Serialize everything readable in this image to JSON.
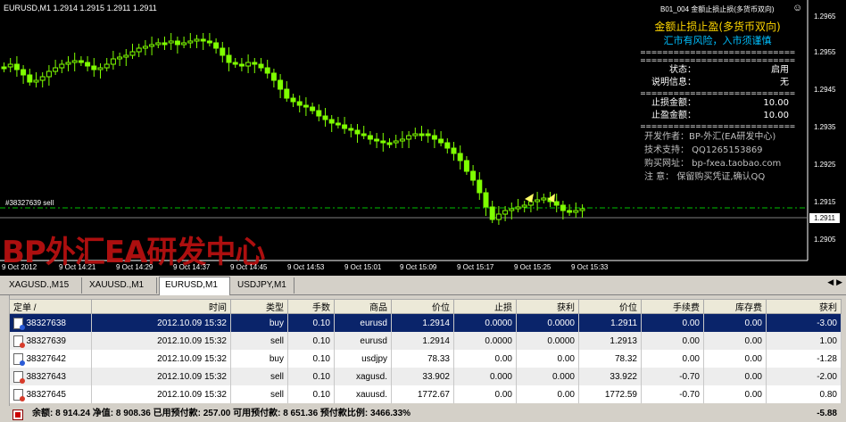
{
  "chart": {
    "title": "EURUSD,M1  1.2914 1.2915 1.2911 1.2911",
    "ea_title": "B01_004 金额止损止损(多货币双向)",
    "order_line_label": "#38327639 sell",
    "watermark": "BP外汇EA研发中心",
    "current_price": "1.2911",
    "price_labels": [
      "1.2965",
      "1.2955",
      "1.2945",
      "1.2935",
      "1.2925",
      "1.2915",
      "1.2905"
    ],
    "time_labels": [
      "9 Oct 2012",
      "9 Oct 14:21",
      "9 Oct 14:29",
      "9 Oct 14:37",
      "9 Oct 14:45",
      "9 Oct 14:53",
      "9 Oct 15:01",
      "9 Oct 15:09",
      "9 Oct 15:17",
      "9 Oct 15:25",
      "9 Oct 15:33"
    ],
    "colors": {
      "background": "#000000",
      "candle": "#7fff00",
      "order_line": "#00c000",
      "price_line": "#808080"
    }
  },
  "ea_panel": {
    "heading": "金额止损止盈(多货币双向)",
    "subheading": "汇市有风险，入市须谨慎",
    "separator": "============================",
    "rows": [
      {
        "key": "状态：",
        "value": "启用"
      },
      {
        "key": "说明信息：",
        "value": "无"
      }
    ],
    "money_rows": [
      {
        "key": "止损金额：",
        "value": "10.00"
      },
      {
        "key": "止盈金额：",
        "value": "10.00"
      }
    ],
    "info": [
      "开发作者：BP-外汇(EA研发中心)",
      "技术支持：    QQ1265153869",
      "购买网址：  bp-fxea.taobao.com",
      "注    意：  保留购买凭证,确认QQ"
    ],
    "colors": {
      "heading": "#ffd700",
      "subheading": "#00bfff",
      "keys": "#ffffff"
    }
  },
  "tabs": [
    {
      "label": "XAGUSD.,M15"
    },
    {
      "label": "XAUUSD.,M1"
    },
    {
      "label": "EURUSD,M1",
      "active": true
    },
    {
      "label": "USDJPY,M1"
    }
  ],
  "table": {
    "headers": [
      "定单  /",
      "时间",
      "类型",
      "手数",
      "商品",
      "价位",
      "止损",
      "获利",
      "价位",
      "手续费",
      "库存费",
      "获利"
    ],
    "rows": [
      [
        "38327638",
        "2012.10.09 15:32",
        "buy",
        "0.10",
        "eurusd",
        "1.2914",
        "0.0000",
        "0.0000",
        "1.2911",
        "0.00",
        "0.00",
        "-3.00"
      ],
      [
        "38327639",
        "2012.10.09 15:32",
        "sell",
        "0.10",
        "eurusd",
        "1.2914",
        "0.0000",
        "0.0000",
        "1.2913",
        "0.00",
        "0.00",
        "1.00"
      ],
      [
        "38327642",
        "2012.10.09 15:32",
        "buy",
        "0.10",
        "usdjpy",
        "78.33",
        "0.00",
        "0.00",
        "78.32",
        "0.00",
        "0.00",
        "-1.28"
      ],
      [
        "38327643",
        "2012.10.09 15:32",
        "sell",
        "0.10",
        "xagusd.",
        "33.902",
        "0.000",
        "0.000",
        "33.922",
        "-0.70",
        "0.00",
        "-2.00"
      ],
      [
        "38327645",
        "2012.10.09 15:32",
        "sell",
        "0.10",
        "xauusd.",
        "1772.67",
        "0.00",
        "0.00",
        "1772.59",
        "-0.70",
        "0.00",
        "0.80"
      ]
    ],
    "selected_index": 0
  },
  "summary": {
    "text": "余额: 8 914.24  净值: 8 908.36  已用预付款: 257.00  可用预付款: 8 651.36  预付款比例: 3466.33%",
    "profit": "-5.88"
  }
}
